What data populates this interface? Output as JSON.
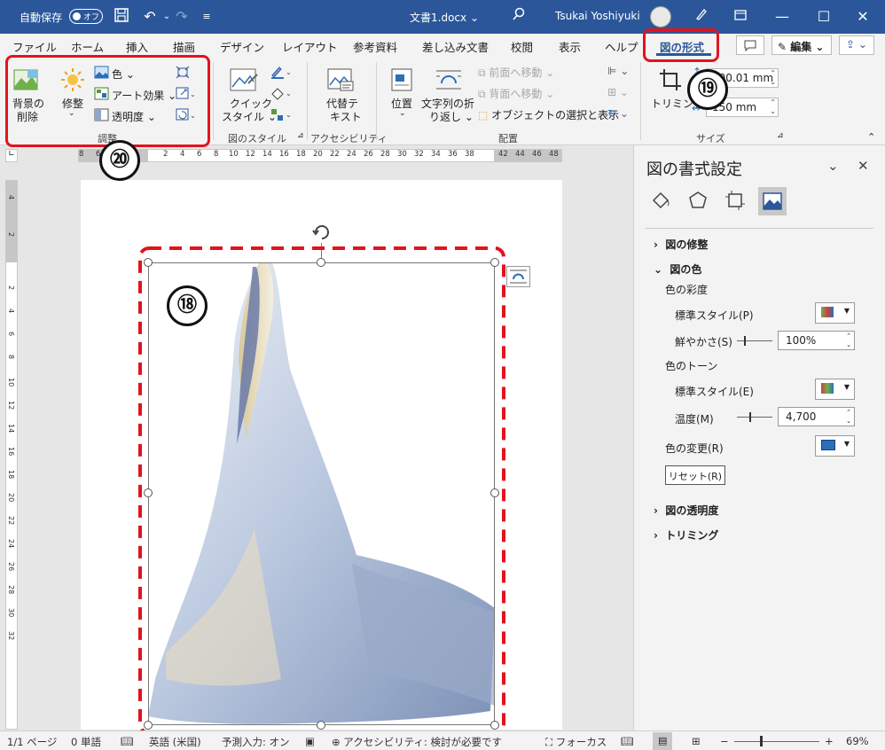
{
  "titlebar": {
    "autosave": "自動保存",
    "toggle": "オフ",
    "doc": "文書1.docx",
    "doc_caret": "⌄",
    "user": "Tsukai Yoshiyuki"
  },
  "tabs": [
    "ファイル",
    "ホーム",
    "挿入",
    "描画",
    "デザイン",
    "レイアウト",
    "参考資料",
    "差し込み文書",
    "校閲",
    "表示",
    "ヘルプ",
    "図の形式"
  ],
  "tab_right": {
    "edit": "編集"
  },
  "ribbon": {
    "bg_remove": [
      "背景の",
      "削除"
    ],
    "corrections": "修整",
    "color": "色",
    "art": "アート効果",
    "transparency": "透明度",
    "adjust_group": "調整",
    "quick_style": [
      "クイック",
      "スタイル"
    ],
    "style_group": "図のスタイル",
    "alt_text": [
      "代替テ",
      "キスト"
    ],
    "access_group": "アクセシビリティ",
    "position": "位置",
    "wrap": [
      "文字列の折",
      "り返し"
    ],
    "bring_forward": "前面へ移動",
    "send_backward": "背面へ移動",
    "selection_pane": "オブジェクトの選択と表示",
    "arrange_group": "配置",
    "crop": "トリミング",
    "height": "100.01 mm",
    "width": "150 mm",
    "size_group": "サイズ"
  },
  "ruler_top": [
    "8",
    "6",
    "4",
    "2",
    "",
    "2",
    "4",
    "6",
    "8",
    "10",
    "12",
    "14",
    "16",
    "18",
    "20",
    "22",
    "24",
    "26",
    "28",
    "30",
    "32",
    "34",
    "36",
    "38",
    "",
    "42",
    "44",
    "46",
    "48"
  ],
  "ruler_left": [
    "4",
    "",
    "2",
    "",
    "",
    "2",
    "4",
    "6",
    "8",
    "10",
    "12",
    "14",
    "16",
    "18",
    "20",
    "22",
    "24",
    "26",
    "28",
    "30",
    "32"
  ],
  "pane": {
    "title": "図の書式設定",
    "close": "✕",
    "collapse": "⌄",
    "sec_fix": "図の修整",
    "sec_color": "図の色",
    "saturation": "色の彩度",
    "preset1": "標準スタイル(P)",
    "vivid": "鮮やかさ(S)",
    "vivid_val": "100%",
    "tone": "色のトーン",
    "preset2": "標準スタイル(E)",
    "temp": "温度(M)",
    "temp_val": "4,700",
    "recolor": "色の変更(R)",
    "reset": "リセット(R)",
    "sec_trans": "図の透明度",
    "sec_crop": "トリミング"
  },
  "status": {
    "page": "1/1 ページ",
    "words": "0 単語",
    "lang": "英語 (米国)",
    "predict": "予測入力: オン",
    "access": "アクセシビリティ: 検討が必要です",
    "focus": "フォーカス",
    "zoom_minus": "−",
    "zoom_plus": "+",
    "zoom": "69%"
  },
  "annotations": {
    "n18": "⑱",
    "n19": "⑲",
    "n20": "⑳"
  },
  "colors": {
    "accent": "#2b579a",
    "annotation": "#e0141e"
  }
}
